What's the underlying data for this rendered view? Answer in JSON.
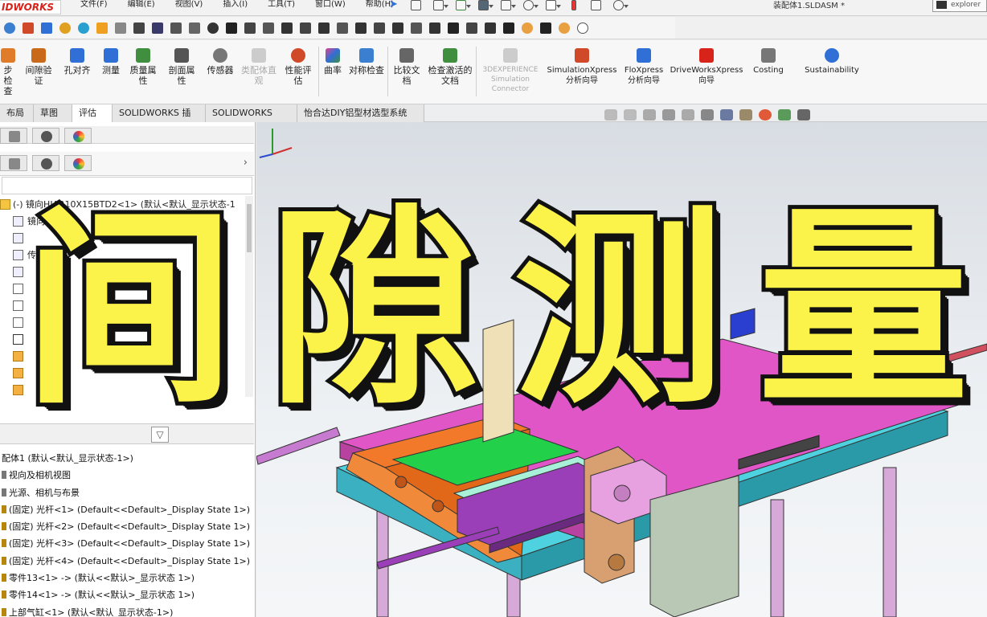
{
  "app": {
    "logo_text": "IDWORKS",
    "document_title": "装配体1.SLDASM *",
    "explorer_label": "explorer"
  },
  "menu": [
    "文件(F)",
    "编辑(E)",
    "视图(V)",
    "插入(I)",
    "工具(T)",
    "窗口(W)",
    "帮助(H)"
  ],
  "ribbon": {
    "buttons": [
      {
        "label": "步检查",
        "color": "#e07b2a"
      },
      {
        "label": "间隙验证",
        "color": "#c96a1a"
      },
      {
        "label": "孔对齐",
        "color": "#2f6fd6"
      },
      {
        "label": "测量",
        "color": "#2f6fd6"
      },
      {
        "label": "质量属性",
        "color": "#3f8f3f"
      },
      {
        "label": "剖面属性",
        "color": "#555555"
      },
      {
        "label": "传感器",
        "color": "#777777"
      },
      {
        "label": "类配体直观",
        "color": "#bbbbbb",
        "dim": true
      },
      {
        "label": "性能评估",
        "color": "#d04a2a"
      },
      {
        "label": "曲率",
        "color": "#e04090"
      },
      {
        "label": "对称检查",
        "color": "#3a7fd0"
      },
      {
        "label": "比较文档",
        "color": "#555555"
      },
      {
        "label": "检查激活的文档",
        "color": "#3f8f3f"
      },
      {
        "label": "3DEXPERIENCE Simulation Connector",
        "color": "#bbbbbb",
        "dim": true
      },
      {
        "label": "SimulationXpress 分析向导",
        "color": "#d04a2a"
      },
      {
        "label": "FloXpress 分析向导",
        "color": "#2f6fd6"
      },
      {
        "label": "DriveWorksXpress 向导",
        "color": "#d7231a"
      },
      {
        "label": "Costing",
        "color": "#666666"
      },
      {
        "label": "Sustainability",
        "color": "#2f6fd6"
      }
    ]
  },
  "tabs": [
    "布局",
    "草图",
    "评估",
    "SOLIDWORKS 插件",
    "SOLIDWORKS MBD",
    "怡合达DIY铝型材选型系统"
  ],
  "active_tab": "评估",
  "feature_tree_top": [
    "(-) 镜向HJAR10X15BTD2<1> (默认<默认_显示状态-1",
    "镜向",
    "",
    "传感"
  ],
  "feature_tree_low": [
    "配体1 (默认<默认_显示状态-1>)",
    "视向及相机视图",
    "光源、相机与布景",
    "(固定) 光杆<1> (Default<<Default>_Display State 1>)",
    "(固定) 光杆<2> (Default<<Default>_Display State 1>)",
    "(固定) 光杆<3> (Default<<Default>_Display State 1>)",
    "(固定) 光杆<4> (Default<<Default>_Display State 1>)",
    "零件13<1> -> (默认<<默认>_显示状态 1>)",
    "零件14<1> -> (默认<<默认>_显示状态 1>)",
    "上部气缸<1> (默认<默认_显示状态-1>)"
  ],
  "overlay": {
    "title_chars": [
      "间",
      "隙",
      "测",
      "量"
    ],
    "fill_color": "#fbf34a",
    "stroke_color": "#111111"
  },
  "icons": {
    "pin": "pin-icon",
    "filter": "filter-icon",
    "chevron": "chevron-right-icon"
  }
}
